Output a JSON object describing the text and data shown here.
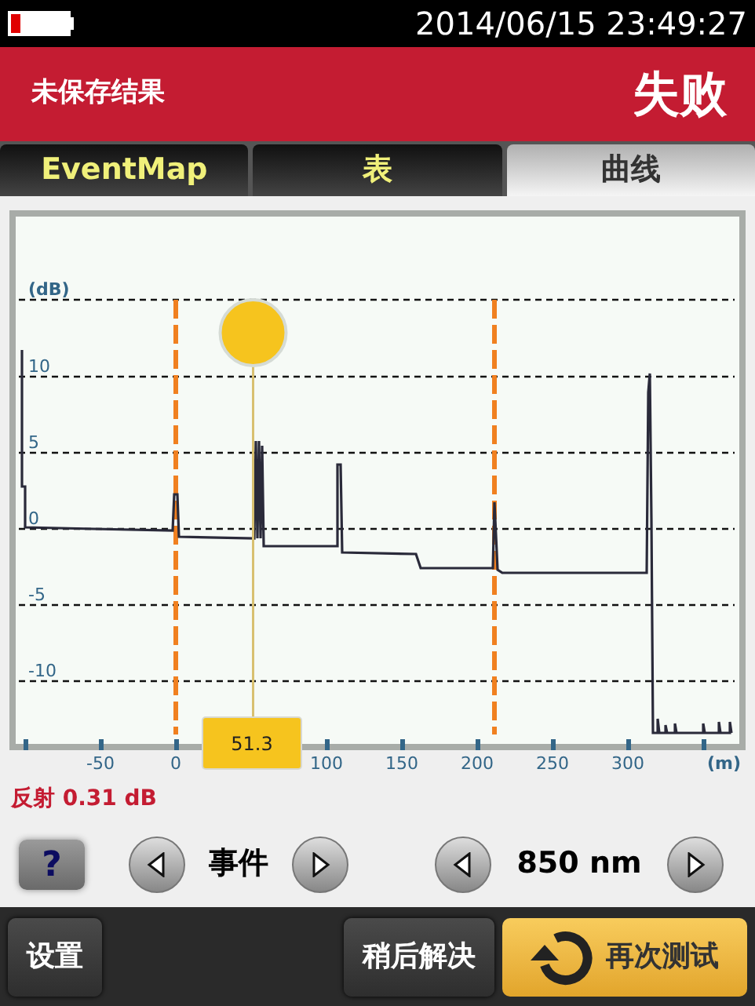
{
  "status_bar": {
    "datetime": "2014/06/15 23:49:27"
  },
  "header": {
    "title": "未保存结果",
    "result": "失败"
  },
  "tabs": [
    {
      "label": "EventMap",
      "selected": false
    },
    {
      "label": "表",
      "selected": false
    },
    {
      "label": "曲线",
      "selected": true
    }
  ],
  "trace_view": {
    "y_unit": "(dB)",
    "y_ticks": [
      "10",
      "5",
      "0",
      "-5",
      "-10"
    ],
    "x_ticks": [
      "-50",
      "0",
      "100",
      "150",
      "200",
      "250",
      "300"
    ],
    "x_unit": "(m)",
    "cursor_value": "51.3"
  },
  "reflectance": "反射 0.31 dB",
  "help_button": "?",
  "selectors": [
    {
      "label": "事件"
    },
    {
      "label": "850 nm"
    }
  ],
  "buttons": [
    {
      "label": "设置",
      "kind": "normal"
    },
    {
      "label": "稍后解决",
      "kind": "normal"
    },
    {
      "label": "再次测试",
      "kind": "primary"
    }
  ]
}
